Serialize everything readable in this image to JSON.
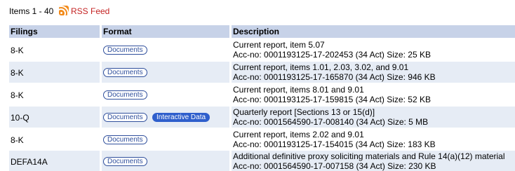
{
  "header": {
    "items_count": "Items 1 - 40",
    "rss_label": "RSS Feed"
  },
  "columns": [
    "Filings",
    "Format",
    "Description"
  ],
  "rows": [
    {
      "filing": "8-K",
      "formats": [
        "Documents"
      ],
      "desc_line1": "Current report, item 5.07",
      "desc_line2": "Acc-no: 0001193125-17-202453 (34 Act)  Size: 25 KB"
    },
    {
      "filing": "8-K",
      "formats": [
        "Documents"
      ],
      "desc_line1": "Current report, items 1.01, 2.03, 3.02, and 9.01",
      "desc_line2": "Acc-no: 0001193125-17-165870 (34 Act)  Size: 946 KB"
    },
    {
      "filing": "8-K",
      "formats": [
        "Documents"
      ],
      "desc_line1": "Current report, items 8.01 and 9.01",
      "desc_line2": "Acc-no: 0001193125-17-159815 (34 Act)  Size: 52 KB"
    },
    {
      "filing": "10-Q",
      "formats": [
        "Documents",
        "Interactive Data"
      ],
      "desc_line1": "Quarterly report [Sections 13 or 15(d)]",
      "desc_line2": "Acc-no: 0001564590-17-008140 (34 Act)  Size: 5 MB"
    },
    {
      "filing": "8-K",
      "formats": [
        "Documents"
      ],
      "desc_line1": "Current report, items 2.02 and 9.01",
      "desc_line2": "Acc-no: 0001193125-17-154015 (34 Act)  Size: 183 KB"
    },
    {
      "filing": "DEFA14A",
      "formats": [
        "Documents"
      ],
      "desc_line1": "Additional definitive proxy soliciting materials and Rule 14(a)(12) material",
      "desc_line2": "Acc-no: 0001564590-17-007158 (34 Act)  Size: 230 KB"
    }
  ],
  "colors": {
    "header_bg": "#c7d2e8",
    "alt_row_bg": "#e6ecf5",
    "rss_link": "#c42323",
    "badge_blue": "#2f5fcc"
  }
}
